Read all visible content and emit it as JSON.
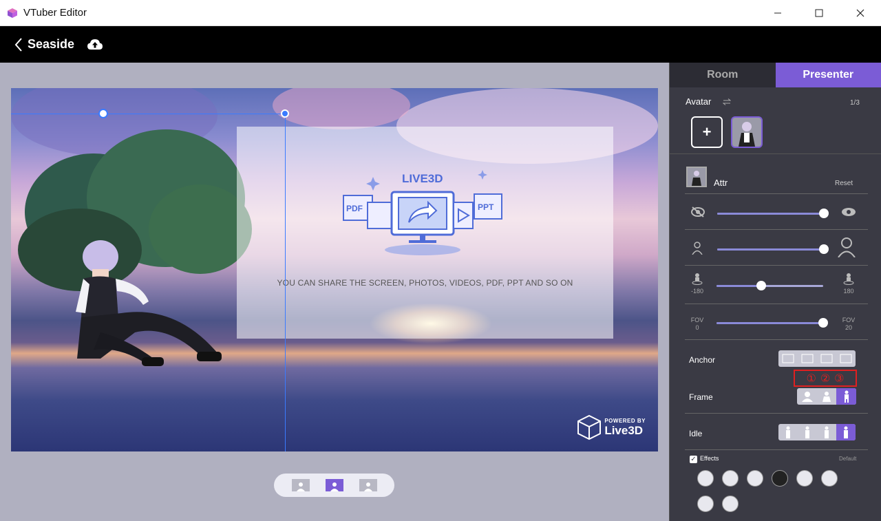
{
  "window": {
    "title": "VTuber Editor",
    "minimize": "—",
    "maximize": "☐",
    "close": "✕"
  },
  "header": {
    "back": "‹",
    "title": "Seaside"
  },
  "canvas": {
    "share_text": "YOU CAN SHARE THE SCREEN, PHOTOS, VIDEOS, PDF, PPT AND SO ON",
    "logo_text": "LIVE3D",
    "pdf_label": "PDF",
    "ppt_label": "PPT",
    "powered_small": "POWERED BY",
    "powered_big": "Live3D"
  },
  "panel": {
    "tabs": [
      {
        "label": "Room"
      },
      {
        "label": "Presenter"
      }
    ],
    "avatar_label": "Avatar",
    "avatar_count": "1/3",
    "add_label": "+",
    "attr_label": "Attr",
    "reset_label": "Reset",
    "visibility_value": 1.0,
    "scale_value": 1.0,
    "rotation_value": 0.42,
    "rotation_min": "-180",
    "rotation_max": "180",
    "fov_value": 1.0,
    "fov_min_label": "FOV",
    "fov_min": "0",
    "fov_max_label": "FOV",
    "fov_max": "20",
    "anchor_label": "Anchor",
    "annotation": [
      "①",
      "②",
      "③"
    ],
    "frame_label": "Frame",
    "idle_label": "Idle",
    "effects_label": "Effects",
    "effects_default": "Default",
    "effects_checked": "✓"
  },
  "colors": {
    "accent": "#7b5cd6",
    "selection": "#3a7bff",
    "annotation": "#e02020"
  }
}
